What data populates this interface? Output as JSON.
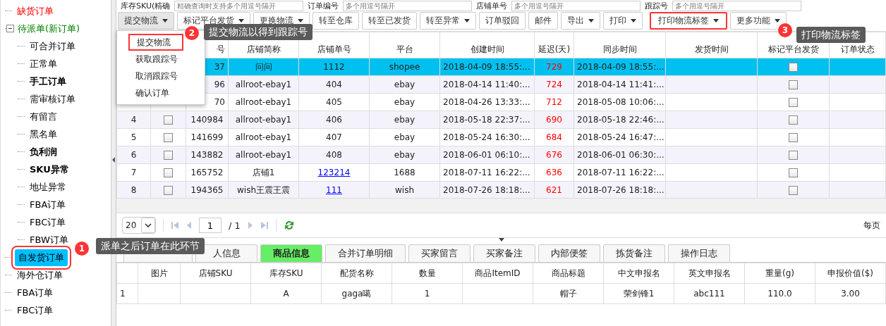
{
  "filters": [
    {
      "label": "库存SKU(精确",
      "placeholder": "精确查询时支持多个用逗号隔开"
    },
    {
      "label": "订单编号",
      "placeholder": "多个用逗号隔开"
    },
    {
      "label": "店铺单号",
      "placeholder": "多个用逗号隔开"
    },
    {
      "label": "跟踪号",
      "placeholder": "多个用逗号隔开"
    }
  ],
  "sidebar": {
    "items": [
      {
        "label": "缺货订单",
        "color": "#ff0000",
        "bold": false,
        "selected": false,
        "highlighted": false
      },
      {
        "label": "待派单(新订单)",
        "color": "#008000",
        "bold": false,
        "selected": false,
        "highlighted": false,
        "expanded": true,
        "children": [
          {
            "label": "可合并订单",
            "bold": false,
            "selected": false
          },
          {
            "label": "正常单",
            "bold": false,
            "selected": false
          },
          {
            "label": "手工订单",
            "bold": true,
            "selected": false
          },
          {
            "label": "需审核订单",
            "bold": false,
            "selected": false
          },
          {
            "label": "有留言",
            "bold": false,
            "selected": false
          },
          {
            "label": "黑名单",
            "bold": false,
            "selected": false
          },
          {
            "label": "负利润",
            "bold": true,
            "selected": false
          },
          {
            "label": "SKU异常",
            "bold": true,
            "selected": false
          },
          {
            "label": "地址异常",
            "bold": false,
            "selected": false
          },
          {
            "label": "FBA订单",
            "bold": false,
            "selected": false
          },
          {
            "label": "FBC订单",
            "bold": false,
            "selected": false
          },
          {
            "label": "FBW订单",
            "bold": false,
            "selected": false
          }
        ]
      },
      {
        "label": "自发货订单",
        "bold": false,
        "selected": true,
        "highlighted": true
      },
      {
        "label": "海外仓订单",
        "bold": false,
        "selected": false,
        "highlighted": false
      },
      {
        "label": "FBA订单",
        "bold": false,
        "selected": false,
        "highlighted": false
      },
      {
        "label": "FBC订单",
        "bold": false,
        "selected": false,
        "highlighted": false
      }
    ]
  },
  "toolbar": {
    "buttons": [
      {
        "label": "提交物流",
        "dropdown": true,
        "expanded": true,
        "highlighted": false,
        "menu": [
          {
            "label": "提交物流",
            "highlighted": true
          },
          {
            "label": "获取跟踪号",
            "highlighted": false
          },
          {
            "label": "取消跟踪号",
            "highlighted": false
          },
          {
            "label": "确认订单",
            "highlighted": false
          }
        ]
      },
      {
        "label": "标记平台发货",
        "dropdown": true,
        "expanded": false,
        "highlighted": false
      },
      {
        "label": "更换物流",
        "dropdown": true,
        "expanded": false,
        "highlighted": false
      },
      {
        "label": "转至仓库",
        "dropdown": false,
        "expanded": false,
        "highlighted": false
      },
      {
        "label": "转至已发货",
        "dropdown": false,
        "expanded": false,
        "highlighted": false
      },
      {
        "label": "转至异常",
        "dropdown": true,
        "expanded": false,
        "highlighted": false
      },
      {
        "label": "订单驳回",
        "dropdown": false,
        "expanded": false,
        "highlighted": false
      },
      {
        "label": "邮件",
        "dropdown": false,
        "expanded": false,
        "highlighted": false
      },
      {
        "label": "导出",
        "dropdown": true,
        "expanded": false,
        "highlighted": false
      },
      {
        "label": "打印",
        "dropdown": true,
        "expanded": false,
        "highlighted": false
      },
      {
        "label": "打印物流标签",
        "dropdown": true,
        "expanded": false,
        "highlighted": true
      },
      {
        "label": "更多功能",
        "dropdown": true,
        "expanded": false,
        "highlighted": false
      }
    ]
  },
  "table": {
    "columns": [
      "号",
      "店铺简称",
      "店铺单号",
      "平台",
      "创建时间",
      "延迟(天)",
      "同步时间",
      "发货时间",
      "标记平台发货",
      "订单状态"
    ],
    "rows": [
      {
        "selected": true,
        "order_id": "37",
        "shop": "问问",
        "shop_order_no": "1112",
        "shop_order_link": false,
        "platform": "shopee",
        "created": "2018-04-09 18:55:...",
        "delay": "729",
        "synced": "2018-04-09 18:55:...",
        "ship_marked": false
      },
      {
        "selected": false,
        "order_id": "96",
        "shop": "allroot-ebay1",
        "shop_order_no": "404",
        "shop_order_link": false,
        "platform": "ebay",
        "created": "2018-04-14 11:40:...",
        "delay": "724",
        "synced": "2018-04-14 11:41:...",
        "ship_marked": false
      },
      {
        "selected": false,
        "order_id": "70",
        "shop": "allroot-ebay1",
        "shop_order_no": "405",
        "shop_order_link": false,
        "platform": "ebay",
        "created": "2018-04-26 13:33:...",
        "delay": "712",
        "synced": "2018-05-08 10:06:...",
        "ship_marked": false
      },
      {
        "selected": false,
        "index": "4",
        "checked": false,
        "order_id": "140984",
        "shop": "allroot-ebay1",
        "shop_order_no": "406",
        "shop_order_link": false,
        "platform": "ebay",
        "created": "2018-05-18 22:37:...",
        "delay": "690",
        "synced": "2018-05-18 22:46:...",
        "ship_marked": false
      },
      {
        "selected": false,
        "index": "5",
        "checked": false,
        "order_id": "141699",
        "shop": "allroot-ebay1",
        "shop_order_no": "407",
        "shop_order_link": false,
        "platform": "ebay",
        "created": "2018-05-24 16:30:...",
        "delay": "684",
        "synced": "2018-05-24 16:47:...",
        "ship_marked": false
      },
      {
        "selected": false,
        "index": "6",
        "checked": false,
        "order_id": "143882",
        "shop": "allroot-ebay1",
        "shop_order_no": "408",
        "shop_order_link": false,
        "platform": "ebay",
        "created": "2018-06-01 06:10:...",
        "delay": "676",
        "synced": "2018-06-01 06:30:...",
        "ship_marked": false
      },
      {
        "selected": false,
        "index": "7",
        "checked": false,
        "order_id": "165752",
        "shop": "店铺1",
        "shop_order_no": "123214",
        "shop_order_link": true,
        "platform": "1688",
        "created": "2018-07-11 16:22:...",
        "delay": "636",
        "synced": "2018-07-11 16:22:...",
        "ship_marked": false
      },
      {
        "selected": false,
        "index": "8",
        "checked": false,
        "order_id": "194365",
        "shop": "wish王震王震",
        "shop_order_no": "111",
        "shop_order_link": true,
        "platform": "wish",
        "created": "2018-07-26 18:18:...",
        "delay": "621",
        "synced": "2018-07-26 18:18:...",
        "ship_marked": false
      }
    ]
  },
  "pagination": {
    "page_size": "20",
    "page": "1",
    "total_pages": "/ 1",
    "per_page_label": "每页"
  },
  "detail_tabs": [
    {
      "selected": false
    },
    {
      "label": "人信息",
      "selected": false
    },
    {
      "label": "商品信息",
      "selected": true
    },
    {
      "label": "合并订单明细",
      "selected": false
    },
    {
      "label": "买家留言",
      "selected": false
    },
    {
      "label": "买家备注",
      "selected": false
    },
    {
      "label": "内部便签",
      "selected": false
    },
    {
      "label": "拣货备注",
      "selected": false
    },
    {
      "label": "操作日志",
      "selected": false
    }
  ],
  "goods_table": {
    "columns": [
      "",
      "图片",
      "店铺SKU",
      "库存SKU",
      "配货名称",
      "数量",
      "商品ItemID",
      "商品标题",
      "中文申报名",
      "英文申报名",
      "重量(g)",
      "申报价值($)"
    ],
    "rows": [
      [
        "1",
        "",
        "",
        "A",
        "gaga噶",
        "1",
        "",
        "帽子",
        "荣剑锋1",
        "abc111",
        "110.0",
        "3.00"
      ]
    ]
  },
  "annotations": [
    {
      "number": "1",
      "text": "派单之后订单在此环节"
    },
    {
      "number": "2",
      "text": "提交物流以得到跟踪号"
    },
    {
      "number": "3",
      "text": "打印物流标签"
    }
  ]
}
